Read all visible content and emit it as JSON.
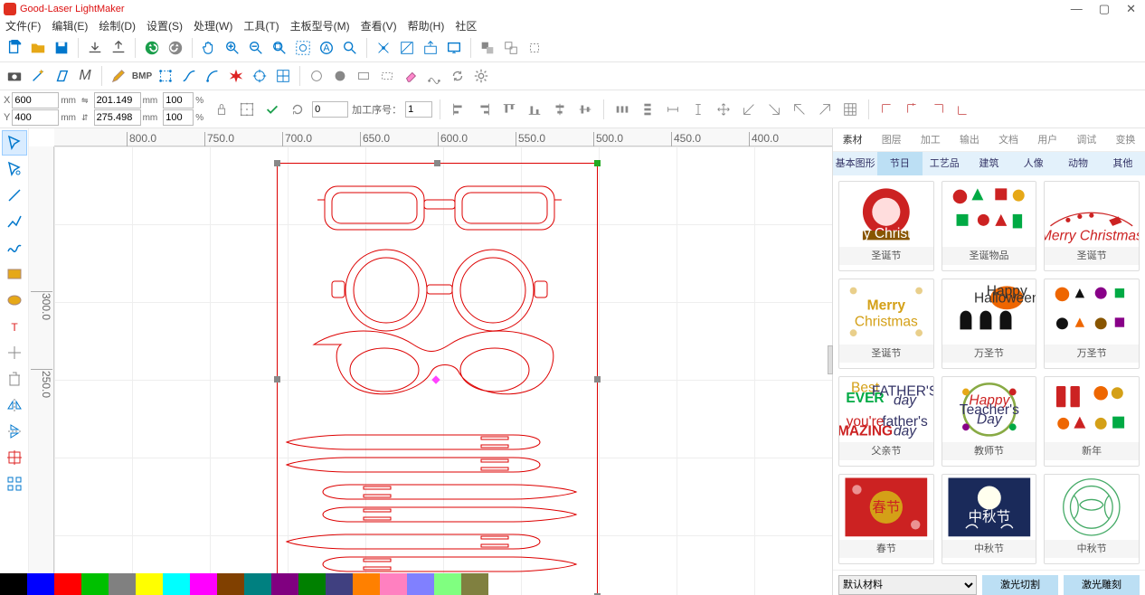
{
  "app": {
    "title": "Good-Laser LightMaker"
  },
  "menu": [
    "文件(F)",
    "编辑(E)",
    "绘制(D)",
    "设置(S)",
    "处理(W)",
    "工具(T)",
    "主板型号(M)",
    "查看(V)",
    "帮助(H)",
    "社区"
  ],
  "win_controls": {
    "min": "—",
    "max": "▢",
    "close": "✕"
  },
  "coords": {
    "x_label": "X",
    "y_label": "Y",
    "x": "600",
    "y": "400",
    "w": "201.149",
    "h": "275.498",
    "mm": "mm",
    "rot": "0",
    "scale1": "100",
    "scale2": "100",
    "pct": "%",
    "proc_label": "加工序号：",
    "proc_no": "1"
  },
  "ruler_h": [
    "800.0",
    "750.0",
    "700.0",
    "650.0",
    "600.0",
    "550.0",
    "500.0",
    "450.0",
    "400.0"
  ],
  "ruler_v": [
    "300.0",
    "250.0"
  ],
  "right": {
    "tabs": [
      "素材",
      "图层",
      "加工",
      "输出",
      "文档",
      "用户",
      "调试",
      "变换"
    ],
    "active_tab": 0,
    "cats": [
      "基本图形",
      "节日",
      "工艺品",
      "建筑",
      "人像",
      "动物",
      "其他"
    ],
    "active_cat": 1,
    "items": [
      {
        "cap": "圣诞节",
        "bg": "#fff",
        "svg": "santa"
      },
      {
        "cap": "圣诞物品",
        "bg": "#fff",
        "svg": "xmas-items"
      },
      {
        "cap": "圣诞节",
        "bg": "#fff",
        "svg": "sleigh"
      },
      {
        "cap": "圣诞节",
        "bg": "#fff",
        "svg": "merry"
      },
      {
        "cap": "万圣节",
        "bg": "#fff",
        "svg": "halloween1"
      },
      {
        "cap": "万圣节",
        "bg": "#fff",
        "svg": "halloween2"
      },
      {
        "cap": "父亲节",
        "bg": "#fff",
        "svg": "fathers"
      },
      {
        "cap": "教师节",
        "bg": "#fff",
        "svg": "teachers"
      },
      {
        "cap": "新年",
        "bg": "#fff",
        "svg": "newyear"
      },
      {
        "cap": "春节",
        "bg": "#fff",
        "svg": "chunjie"
      },
      {
        "cap": "中秋节",
        "bg": "#fff",
        "svg": "midautumn1"
      },
      {
        "cap": "中秋节",
        "bg": "#fff",
        "svg": "midautumn2"
      }
    ],
    "material": "默认材料",
    "btn_cut": "激光切割",
    "btn_engrave": "激光雕刻"
  },
  "palette": [
    "#000000",
    "#0000FF",
    "#FF0000",
    "#00C000",
    "#808080",
    "#FFFF00",
    "#00FFFF",
    "#FF00FF",
    "#804000",
    "#008080",
    "#800080",
    "#008000",
    "#404080",
    "#FF8000",
    "#FF80C0",
    "#8080FF",
    "#80FF80",
    "#808040"
  ],
  "icons": {
    "new": "new",
    "open": "open",
    "save": "save",
    "import": "import",
    "export": "export",
    "undo": "undo",
    "redo": "redo",
    "pan": "pan",
    "zoomin": "zoomin",
    "zoomout": "zoomout",
    "zoomfit": "zoomfit",
    "zoomsel": "zoomsel",
    "zoomobj": "zoomobj",
    "zoomall": "zoomall",
    "snap": "snap",
    "snapg": "snapg",
    "snapo": "snapo",
    "display": "display",
    "g1": "g1",
    "g2": "g2",
    "g3": "g3",
    "r2_1": "camera",
    "r2_2": "magic",
    "r2_3": "skew",
    "r2_4": "em",
    "r2_5": "pen",
    "r2_6": "bmp",
    "r2_7": "box",
    "r2_8": "curve",
    "r2_9": "arc",
    "r2_10": "burst",
    "r2_11": "target",
    "r2_12": "grid",
    "r2_13": "circ1",
    "r2_14": "circ2",
    "r2_15": "rect",
    "r2_16": "rectd",
    "r2_17": "eraser",
    "r2_18": "node",
    "r2_19": "ref",
    "r2_20": "gear",
    "bmp_label": "BMP",
    "M_label": "M"
  }
}
